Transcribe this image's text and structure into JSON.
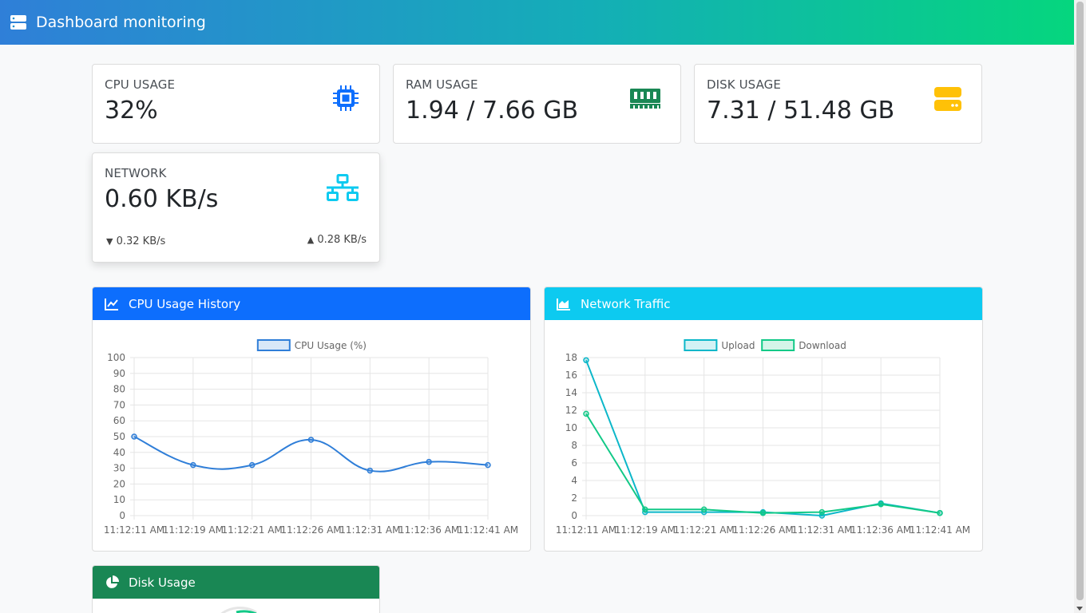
{
  "app": {
    "title": "Dashboard monitoring"
  },
  "stats": {
    "cpu": {
      "label": "CPU USAGE",
      "value": "32%",
      "icon": "cpu-icon",
      "color": "#0d6efd"
    },
    "ram": {
      "label": "RAM USAGE",
      "value": "1.94 / 7.66 GB",
      "icon": "memory-icon",
      "color": "#198754"
    },
    "disk": {
      "label": "DISK USAGE",
      "value": "7.31 / 51.48 GB",
      "icon": "hdd-icon",
      "color": "#ffc107"
    },
    "network": {
      "label": "NETWORK",
      "value": "0.60 KB/s",
      "download": "0.32 KB/s",
      "upload": "0.28 KB/s",
      "icon": "network-icon",
      "color": "#0dcaf0"
    }
  },
  "panels": {
    "cpu_history": {
      "title": "CPU Usage History",
      "icon": "line-chart-icon",
      "color": "#0d6efd"
    },
    "network_traffic": {
      "title": "Network Traffic",
      "icon": "area-chart-icon",
      "color": "#0dcaf0"
    },
    "disk_usage": {
      "title": "Disk Usage",
      "icon": "pie-chart-icon",
      "color": "#198754"
    }
  },
  "chart_data": [
    {
      "type": "line",
      "legend_position": "top",
      "x": [
        "11:12:11 AM",
        "11:12:19 AM",
        "11:12:21 AM",
        "11:12:26 AM",
        "11:12:31 AM",
        "11:12:36 AM",
        "11:12:41 AM"
      ],
      "series": [
        {
          "name": "CPU Usage (%)",
          "color": "#2f7ed8",
          "values": [
            50,
            32,
            32,
            48,
            28.5,
            34,
            32
          ]
        }
      ],
      "ylim": [
        0,
        100
      ],
      "yticks": [
        0,
        10,
        20,
        30,
        40,
        50,
        60,
        70,
        80,
        90,
        100
      ],
      "grid": true
    },
    {
      "type": "line",
      "legend_position": "top",
      "x": [
        "11:12:11 AM",
        "11:12:19 AM",
        "11:12:21 AM",
        "11:12:26 AM",
        "11:12:31 AM",
        "11:12:36 AM",
        "11:12:41 AM"
      ],
      "series": [
        {
          "name": "Upload",
          "color": "#0cb7c9",
          "values": [
            17.7,
            0.4,
            0.4,
            0.4,
            0,
            1.4,
            0.3
          ]
        },
        {
          "name": "Download",
          "color": "#12c987",
          "values": [
            11.6,
            0.7,
            0.7,
            0.3,
            0.4,
            1.3,
            0.3
          ]
        }
      ],
      "ylim": [
        0,
        18
      ],
      "yticks": [
        0,
        2,
        4,
        6,
        8,
        10,
        12,
        14,
        16,
        18
      ],
      "grid": true
    }
  ]
}
